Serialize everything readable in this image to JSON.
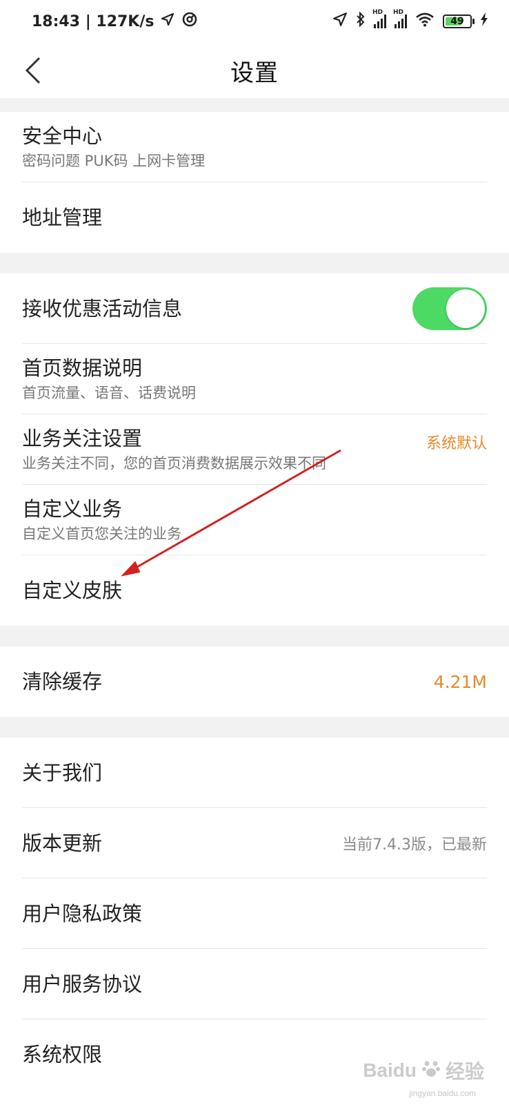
{
  "status_bar": {
    "time_speed": "18:43 | 127K/s",
    "hd1": "HD",
    "hd2": "HD",
    "battery": "49"
  },
  "header": {
    "title": "设置"
  },
  "sections": {
    "security_center": {
      "title": "安全中心",
      "subtitle": "密码问题 PUK码 上网卡管理"
    },
    "address": {
      "title": "地址管理"
    },
    "promo": {
      "title": "接收优惠活动信息",
      "toggle_on": true
    },
    "home_data": {
      "title": "首页数据说明",
      "subtitle": "首页流量、语音、话费说明"
    },
    "business_follow": {
      "title": "业务关注设置",
      "subtitle": "业务关注不同，您的首页消费数据展示效果不同",
      "value": "系统默认"
    },
    "custom_business": {
      "title": "自定义业务",
      "subtitle": "自定义首页您关注的业务"
    },
    "custom_skin": {
      "title": "自定义皮肤"
    },
    "clear_cache": {
      "title": "清除缓存",
      "value": "4.21M"
    },
    "about": {
      "title": "关于我们"
    },
    "version": {
      "title": "版本更新",
      "value": "当前7.4.3版，已最新"
    },
    "privacy": {
      "title": "用户隐私政策"
    },
    "service": {
      "title": "用户服务协议"
    },
    "permissions": {
      "title": "系统权限"
    }
  },
  "watermark": {
    "brand": "Baidu",
    "cn": "经验",
    "url": "jingyan.baidu.com"
  },
  "colors": {
    "accent": "#e8892a",
    "toggle": "#4cd964",
    "annotation_arrow": "#d42020",
    "section_gap": "#f2f2f2"
  }
}
